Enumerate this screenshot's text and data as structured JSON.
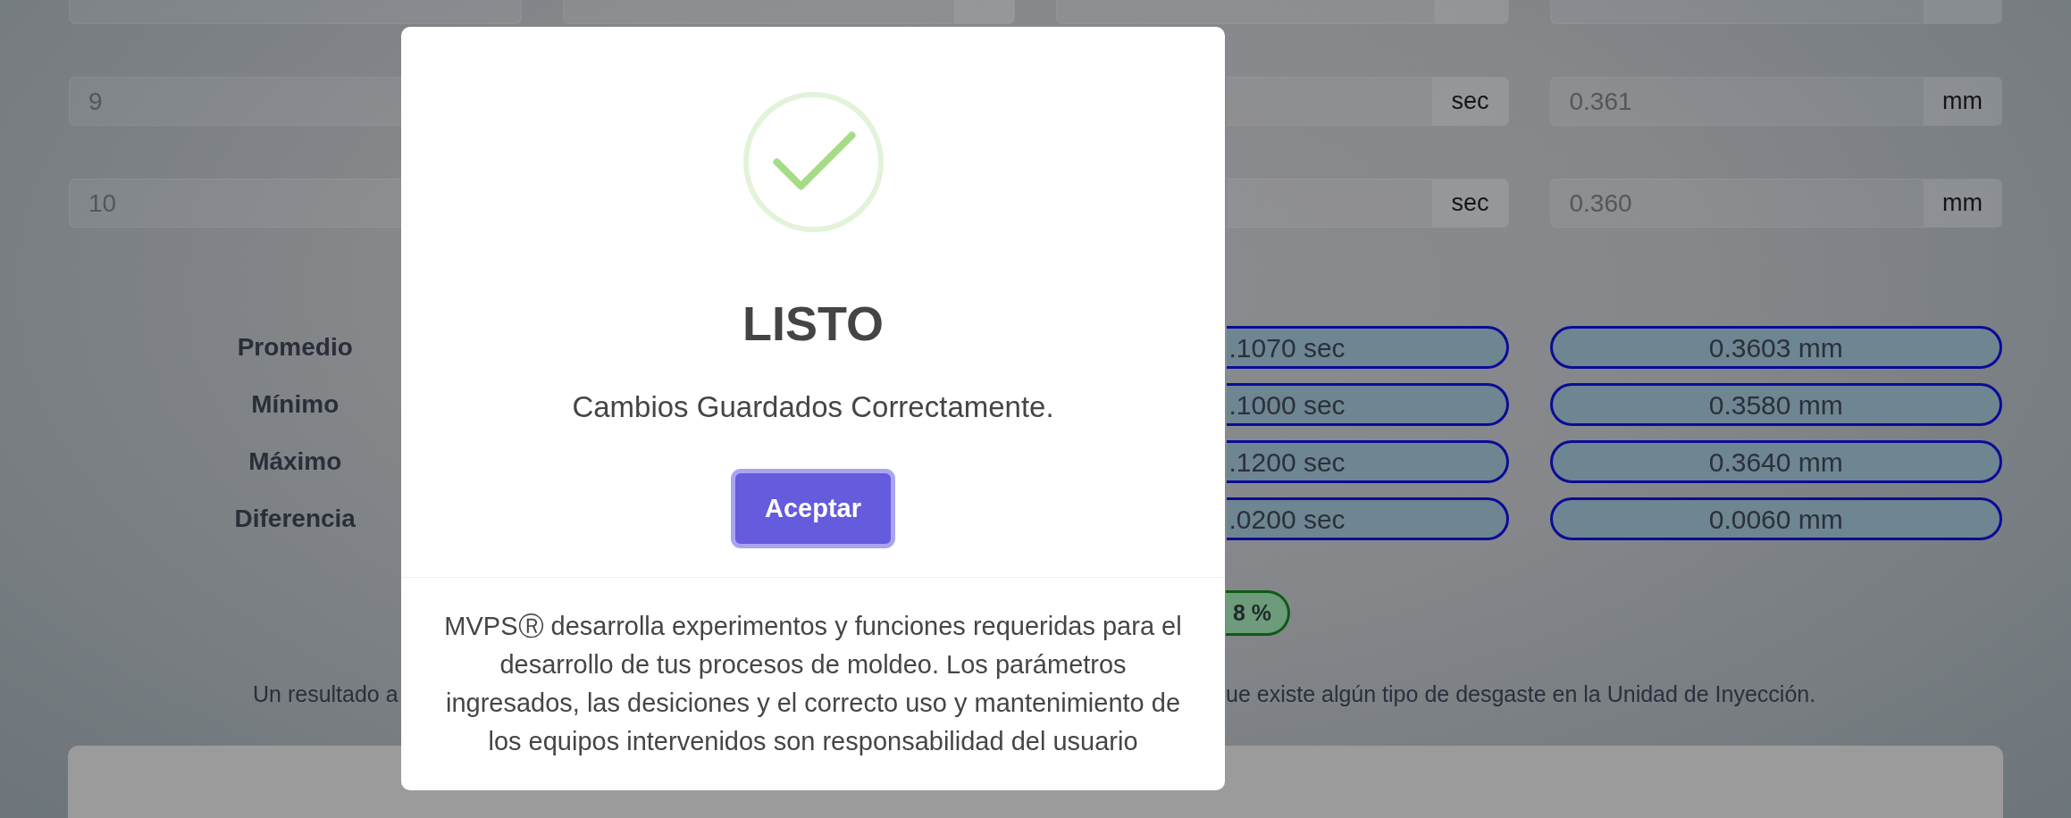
{
  "rows": [
    {
      "number": "9",
      "fields": [
        {
          "unit": "sec"
        },
        {
          "value": "0.361",
          "unit": "mm"
        }
      ]
    },
    {
      "number": "10",
      "fields": [
        {
          "unit": "sec"
        },
        {
          "value": "0.360",
          "unit": "mm"
        }
      ]
    }
  ],
  "summary": [
    {
      "label": "Promedio",
      "values": [
        ".1070 sec",
        "0.3603 mm"
      ]
    },
    {
      "label": "Mínimo",
      "values": [
        ".1000 sec",
        "0.3580 mm"
      ]
    },
    {
      "label": "Máximo",
      "values": [
        ".1200 sec",
        "0.3640 mm"
      ]
    },
    {
      "label": "Diferencia",
      "values": [
        ".0200 sec",
        "0.0060 mm"
      ]
    }
  ],
  "result_badge": "8 %",
  "note": {
    "start": "Un resultado a",
    "end": "ue existe algún tipo de desgaste en la Unidad de Inyección."
  },
  "dialog": {
    "title": "LISTO",
    "message": "Cambios Guardados Correctamente.",
    "button": "Aceptar",
    "footer": "MVPSⓇ desarrolla experimentos y funciones requeridas para el desarrollo de tus procesos de moldeo. Los parámetros ingresados, las desiciones y el correcto uso y mantenimiento de los equipos intervenidos son responsabilidad del usuario"
  }
}
